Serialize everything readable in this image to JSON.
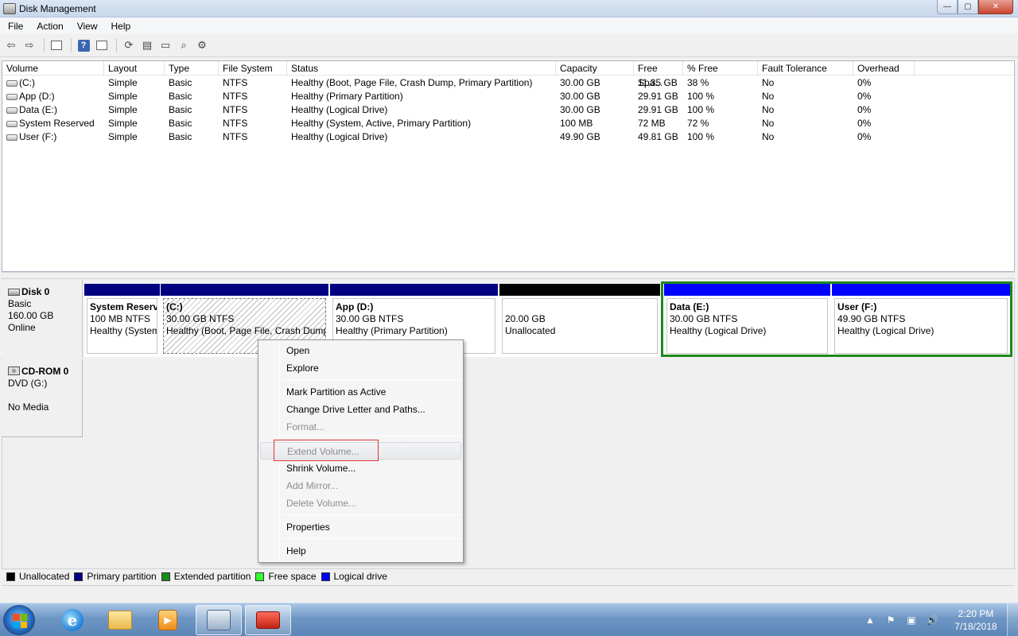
{
  "window": {
    "title": "Disk Management",
    "min_label": "—",
    "max_label": "▢",
    "close_label": "✕"
  },
  "menu": [
    "File",
    "Action",
    "View",
    "Help"
  ],
  "toolbar": {
    "icons": [
      "back-arrow-icon",
      "forward-arrow-icon",
      "show-hide-console-tree-icon",
      "help-icon",
      "properties-icon",
      "refresh-icon",
      "rescan-disks-icon",
      "open-icon",
      "explore-icon",
      "settings-icon"
    ]
  },
  "volume_list": {
    "columns": [
      "Volume",
      "Layout",
      "Type",
      "File System",
      "Status",
      "Capacity",
      "Free Spa...",
      "% Free",
      "Fault Tolerance",
      "Overhead"
    ],
    "rows": [
      [
        "(C:)",
        "Simple",
        "Basic",
        "NTFS",
        "Healthy (Boot, Page File, Crash Dump, Primary Partition)",
        "30.00 GB",
        "11.35 GB",
        "38 %",
        "No",
        "0%"
      ],
      [
        "App (D:)",
        "Simple",
        "Basic",
        "NTFS",
        "Healthy (Primary Partition)",
        "30.00 GB",
        "29.91 GB",
        "100 %",
        "No",
        "0%"
      ],
      [
        "Data (E:)",
        "Simple",
        "Basic",
        "NTFS",
        "Healthy (Logical Drive)",
        "30.00 GB",
        "29.91 GB",
        "100 %",
        "No",
        "0%"
      ],
      [
        "System Reserved",
        "Simple",
        "Basic",
        "NTFS",
        "Healthy (System, Active, Primary Partition)",
        "100 MB",
        "72 MB",
        "72 %",
        "No",
        "0%"
      ],
      [
        "User (F:)",
        "Simple",
        "Basic",
        "NTFS",
        "Healthy (Logical Drive)",
        "49.90 GB",
        "49.81 GB",
        "100 %",
        "No",
        "0%"
      ]
    ]
  },
  "disk0": {
    "name": "Disk 0",
    "type": "Basic",
    "size": "160.00 GB",
    "status": "Online",
    "partitions": [
      {
        "name": "System Reserved",
        "size": "100 MB NTFS",
        "status": "Healthy (System, Active, Primary Partition)",
        "bar_color": "#000080",
        "hatched": false
      },
      {
        "name": "(C:)",
        "size": "30.00 GB NTFS",
        "status": "Healthy (Boot, Page File, Crash Dump, Primary Partition)",
        "bar_color": "#000080",
        "hatched": true
      },
      {
        "name": "App  (D:)",
        "size": "30.00 GB NTFS",
        "status": "Healthy (Primary Partition)",
        "bar_color": "#000080",
        "hatched": false
      },
      {
        "name": "",
        "size": "20.00 GB",
        "status": "Unallocated",
        "bar_color": "#000000",
        "hatched": false
      },
      {
        "name": "Data  (E:)",
        "size": "30.00 GB NTFS",
        "status": "Healthy (Logical Drive)",
        "bar_color": "#0000ff",
        "hatched": false
      },
      {
        "name": "User  (F:)",
        "size": "49.90 GB NTFS",
        "status": "Healthy (Logical Drive)",
        "bar_color": "#0000ff",
        "hatched": false
      }
    ]
  },
  "cdrom0": {
    "name": "CD-ROM 0",
    "drive": "DVD (G:)",
    "status": "No Media"
  },
  "context_menu": {
    "items": [
      {
        "label": "Open",
        "disabled": false
      },
      {
        "label": "Explore",
        "disabled": false
      },
      {
        "label": "Mark Partition as Active",
        "disabled": false
      },
      {
        "label": "Change Drive Letter and Paths...",
        "disabled": false
      },
      {
        "label": "Format...",
        "disabled": true
      },
      {
        "label": "Extend Volume...",
        "disabled": true
      },
      {
        "label": "Shrink Volume...",
        "disabled": false
      },
      {
        "label": "Add Mirror...",
        "disabled": true
      },
      {
        "label": "Delete Volume...",
        "disabled": true
      },
      {
        "label": "Properties",
        "disabled": false
      },
      {
        "label": "Help",
        "disabled": false
      }
    ]
  },
  "legend": [
    {
      "label": "Unallocated",
      "color": "#000000"
    },
    {
      "label": "Primary partition",
      "color": "#000080"
    },
    {
      "label": "Extended partition",
      "color": "#1c8a1c"
    },
    {
      "label": "Free space",
      "color": "#33ff33"
    },
    {
      "label": "Logical drive",
      "color": "#0000ff"
    }
  ],
  "taskbar": {
    "apps": [
      "internet-explorer-icon",
      "windows-explorer-icon",
      "media-player-icon",
      "disk-management-icon",
      "toolbox-icon"
    ],
    "tray_icons": [
      "show-hidden-icons-icon",
      "action-center-icon",
      "network-icon",
      "volume-icon"
    ],
    "tray_glyphs": {
      "arrow": "▲",
      "flag": "⚑",
      "net": "▣",
      "vol": "🔊"
    },
    "time": "2:20 PM",
    "date": "7/18/2018",
    "media_glyph": "▶",
    "ie_glyph": "e"
  }
}
